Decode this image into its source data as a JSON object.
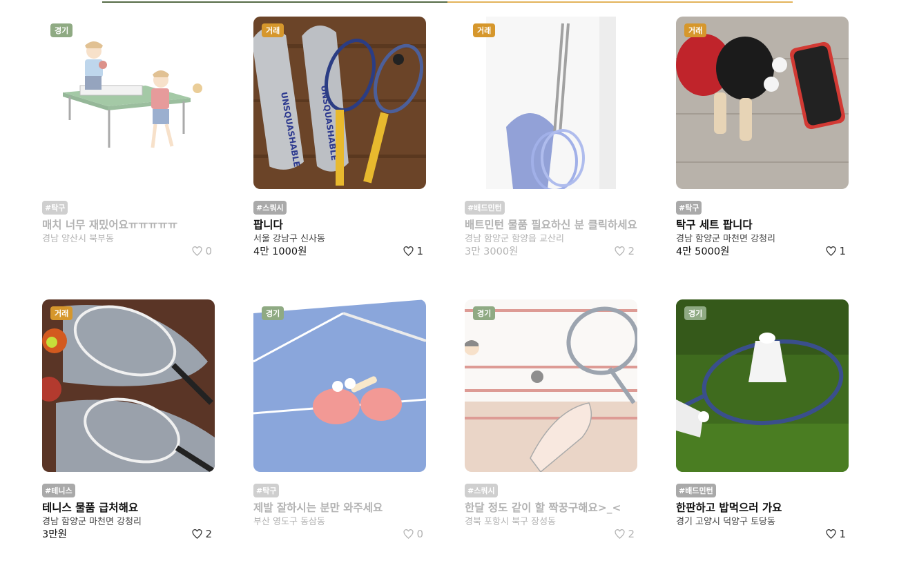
{
  "progress": {
    "percent": 50,
    "colors": {
      "done": "#556b45",
      "rest": "#e3b35a"
    }
  },
  "badge_colors": {
    "match": "#8faa83",
    "trade": "#d6972c"
  },
  "posts": [
    {
      "type": "경기",
      "type_kind": "match",
      "tag": "#탁구",
      "title": "매치 너무 재밌어요ㅠㅠㅠㅠㅠ",
      "location": "경남 양산시 북부동",
      "price": "",
      "likes": "0",
      "image": "ping-pong-players-illustration-icon",
      "faded": true
    },
    {
      "type": "거래",
      "type_kind": "trade",
      "tag": "#스쿼시",
      "title": "팝니다",
      "location": "서울 강남구 신사동",
      "price": "4만 1000원",
      "likes": "1",
      "image": "squash-rackets-photo",
      "faded": false
    },
    {
      "type": "거래",
      "type_kind": "trade",
      "tag": "#배드민턴",
      "title": "배트민턴 물품 필요하신 분 클릭하세요",
      "location": "경남 함양군 함양읍 교산리",
      "price": "3만 3000원",
      "likes": "2",
      "image": "badminton-rackets-photo",
      "faded": true
    },
    {
      "type": "거래",
      "type_kind": "trade",
      "tag": "#탁구",
      "title": "탁구 세트 팝니다",
      "location": "경남 함양군 마천면 강청리",
      "price": "4만 5000원",
      "likes": "1",
      "image": "ping-pong-set-photo",
      "faded": false
    },
    {
      "type": "거래",
      "type_kind": "trade",
      "tag": "#테니스",
      "title": "테니스 물품 급처해요",
      "location": "경남 함양군 마천면 강청리",
      "price": "3만원",
      "likes": "2",
      "image": "tennis-rackets-photo",
      "faded": false
    },
    {
      "type": "경기",
      "type_kind": "match",
      "tag": "#탁구",
      "title": "제발 잘하시는 분만 와주세요",
      "location": "부산 영도구 동삼동",
      "price": "",
      "likes": "0",
      "image": "ping-pong-table-illustration",
      "faded": true
    },
    {
      "type": "경기",
      "type_kind": "match",
      "tag": "#스쿼시",
      "title": "한달 정도 같이 할 짝꿍구해요>_<",
      "location": "경북 포항시 북구 장성동",
      "price": "",
      "likes": "2",
      "image": "squash-court-illustration",
      "faded": true
    },
    {
      "type": "경기",
      "type_kind": "match",
      "tag": "#배드민턴",
      "title": "한판하고 밥먹으러 가요",
      "location": "경기 고양시 덕양구 토당동",
      "price": "",
      "likes": "1",
      "image": "badminton-on-grass-photo",
      "faded": false
    }
  ]
}
